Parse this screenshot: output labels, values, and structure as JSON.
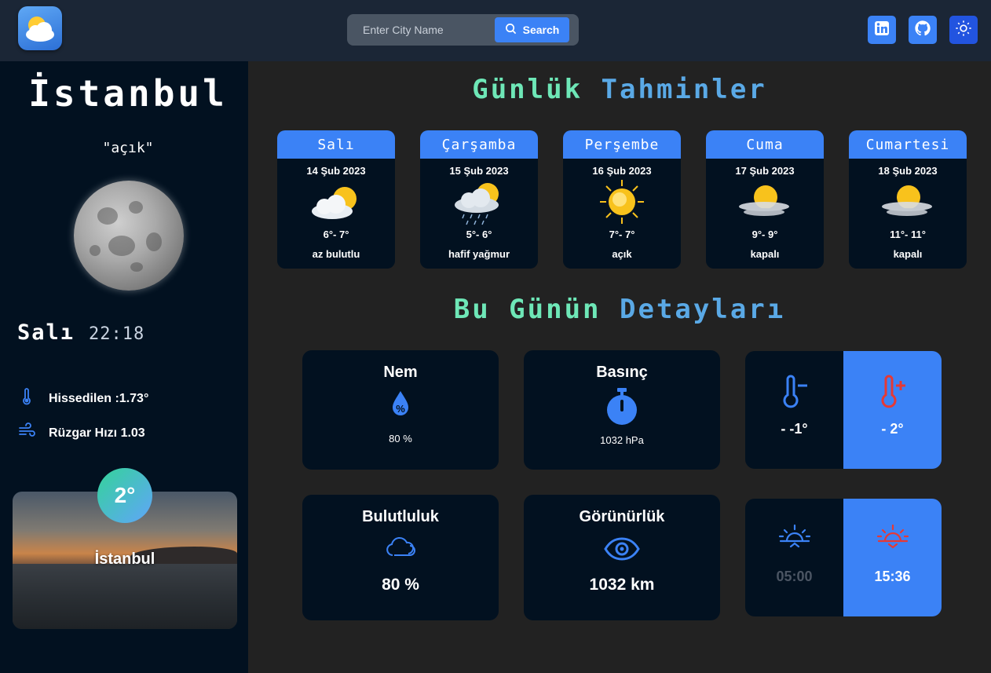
{
  "header": {
    "search_placeholder": "Enter City Name",
    "search_label": "Search",
    "icons": [
      "weather-logo-icon",
      "search-icon",
      "linkedin-icon",
      "github-icon",
      "sun-theme-icon"
    ]
  },
  "sidebar": {
    "city": "İstanbul",
    "condition": "\"açık\"",
    "day": "Salı",
    "time": "22:18",
    "feels_like": "Hissedilen :1.73°",
    "wind": "Rüzgar Hızı 1.03",
    "current_temp": "2°",
    "card_city": "İstanbul"
  },
  "forecast": {
    "title_part1": "Günlük",
    "title_part2": "Tahminler",
    "days": [
      {
        "day": "Salı",
        "date": "14 Şub 2023",
        "temp": "6°- 7°",
        "desc": "az bulutlu",
        "icon": "partly-cloudy-icon"
      },
      {
        "day": "Çarşamba",
        "date": "15 Şub 2023",
        "temp": "5°- 6°",
        "desc": "hafif yağmur",
        "icon": "light-rain-icon"
      },
      {
        "day": "Perşembe",
        "date": "16 Şub 2023",
        "temp": "7°- 7°",
        "desc": "açık",
        "icon": "clear-sun-icon"
      },
      {
        "day": "Cuma",
        "date": "17 Şub 2023",
        "temp": "9°- 9°",
        "desc": "kapalı",
        "icon": "overcast-icon"
      },
      {
        "day": "Cumartesi",
        "date": "18 Şub 2023",
        "temp": "11°- 11°",
        "desc": "kapalı",
        "icon": "overcast-icon"
      }
    ]
  },
  "details": {
    "title_part1": "Bu Günün",
    "title_part2": "Detayları",
    "humidity_label": "Nem",
    "humidity_value": "80 %",
    "pressure_label": "Basınç",
    "pressure_value": "1032 hPa",
    "min_temp": "- -1°",
    "max_temp": "- 2°",
    "cloud_label": "Bulutluluk",
    "cloud_value": "80 %",
    "visibility_label": "Görünürlük",
    "visibility_value": "1032 km",
    "sunrise": "05:00",
    "sunset": "15:36"
  },
  "colors": {
    "accent": "#3b82f6",
    "sidebar_bg": "#021120",
    "main_bg": "#222222",
    "header_bg": "#1b2636",
    "green_title": "#6ee7b7",
    "blue_title": "#5aa9e6",
    "hot_red": "#e53935"
  }
}
